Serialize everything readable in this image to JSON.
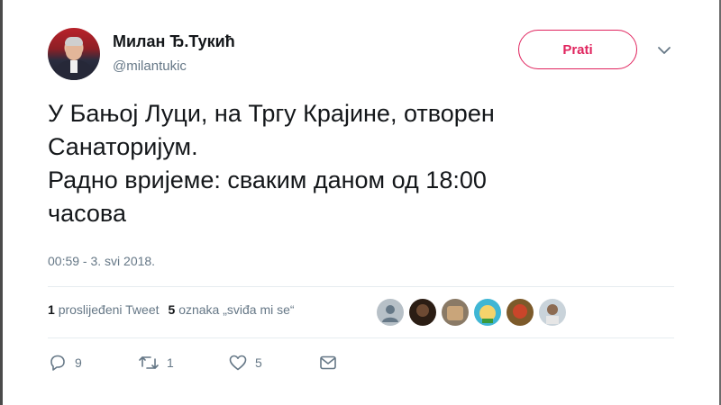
{
  "user": {
    "display_name": "Милан Ђ.Тукић",
    "handle": "@milantukic",
    "avatar": "user-avatar"
  },
  "follow_button": {
    "label": "Prati"
  },
  "menu_icon": "chevron-down-icon",
  "tweet": {
    "lines": [
      "У Бањој Луци, на Тргу Крајине, отворен",
      "Санаторијум.",
      "Радно вријеме: сваким даном од 18:00",
      "часова"
    ],
    "timestamp": "00:59 - 3. svi 2018."
  },
  "stats": {
    "retweets_count": "1",
    "retweets_label": "proslijeđeni Tweet",
    "likes_count": "5",
    "likes_label": "oznaka „sviđa mi se“"
  },
  "likers": [
    {
      "name": "liker-avatar-1",
      "color": "#b7c0c7"
    },
    {
      "name": "liker-avatar-2",
      "color": "#2b1d14"
    },
    {
      "name": "liker-avatar-3",
      "color": "#8a7a66"
    },
    {
      "name": "liker-avatar-4",
      "color": "#3fb6d4"
    },
    {
      "name": "liker-avatar-5",
      "color": "#7c5a2a"
    },
    {
      "name": "liker-avatar-6",
      "color": "#c9d3da"
    }
  ],
  "actions": {
    "reply": {
      "icon": "reply-icon",
      "count": "9"
    },
    "retweet": {
      "icon": "retweet-icon",
      "count": "1"
    },
    "like": {
      "icon": "heart-icon",
      "count": "5"
    },
    "message": {
      "icon": "envelope-icon"
    }
  },
  "colors": {
    "accent": "#e0245e",
    "text": "#14171a",
    "muted": "#657786",
    "divider": "#e6ecf0"
  }
}
